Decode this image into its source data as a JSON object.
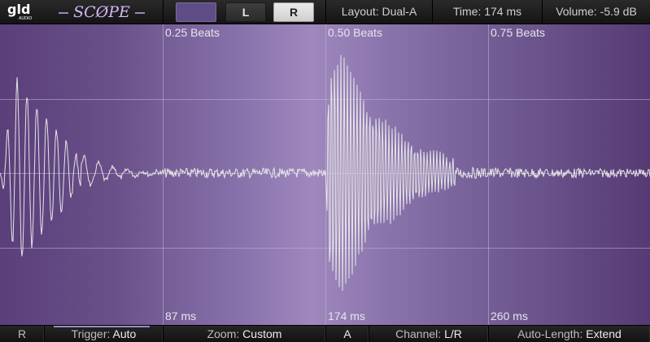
{
  "header": {
    "logo_text": "gld",
    "logo_sub": "AUDIO",
    "product": "SCØPE",
    "channel_l": "L",
    "channel_r": "R",
    "layout": "Layout: Dual-A",
    "time": "Time: 174 ms",
    "volume": "Volume: -5.9 dB",
    "swatch_color": "#5f4d86"
  },
  "plot": {
    "beat_labels": [
      "0.25 Beats",
      "0.50 Beats",
      "0.75 Beats"
    ],
    "ms_labels": [
      "87 ms",
      "174 ms",
      "260 ms"
    ],
    "waveform_color": "#e6e6e6"
  },
  "footer": {
    "channel_button": "R",
    "trigger_label": "Trigger:",
    "trigger_value": "Auto",
    "zoom_label": "Zoom:",
    "zoom_value": "Custom",
    "a_button": "A",
    "channel_label": "Channel:",
    "channel_value": "L/R",
    "autolength_label": "Auto-Length:",
    "autolength_value": "Extend"
  }
}
